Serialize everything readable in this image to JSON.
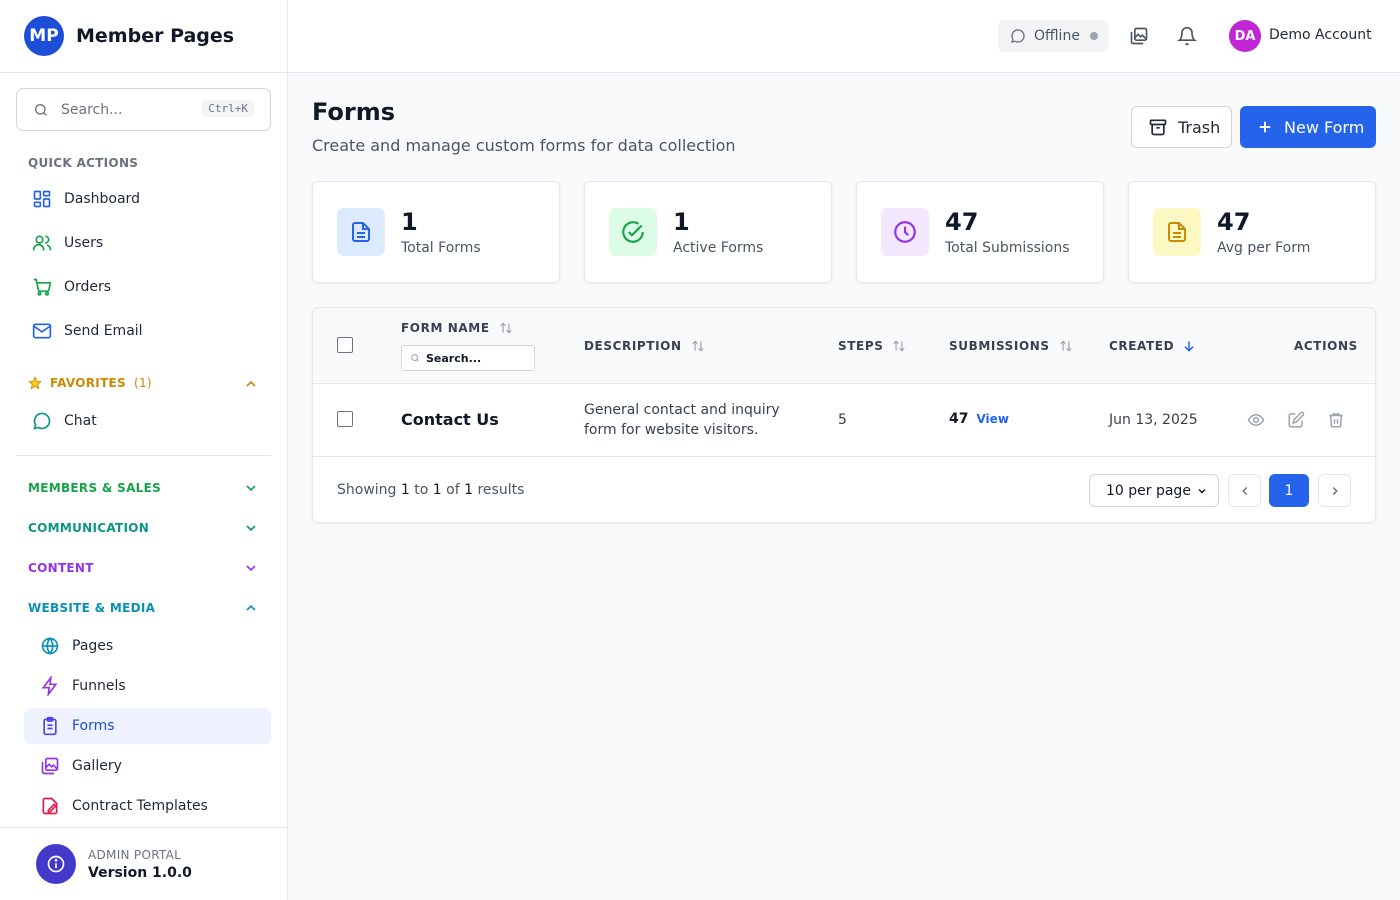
{
  "brand": {
    "logo_text": "MP",
    "name": "Member Pages"
  },
  "search": {
    "placeholder": "Search...",
    "shortcut": "Ctrl+K"
  },
  "sidebar": {
    "quick_actions_label": "QUICK ACTIONS",
    "quick_actions": [
      {
        "label": "Dashboard",
        "icon": "dashboard-icon"
      },
      {
        "label": "Users",
        "icon": "users-icon"
      },
      {
        "label": "Orders",
        "icon": "cart-icon"
      },
      {
        "label": "Send Email",
        "icon": "mail-icon"
      }
    ],
    "favorites_label": "FAVORITES",
    "favorites_count": "(1)",
    "favorites": [
      {
        "label": "Chat",
        "icon": "chat-icon"
      }
    ],
    "groups": [
      {
        "label": "MEMBERS & SALES",
        "color": "#16a34a"
      },
      {
        "label": "COMMUNICATION",
        "color": "#0d9488"
      },
      {
        "label": "CONTENT",
        "color": "#9333ea"
      },
      {
        "label": "WEBSITE & MEDIA",
        "color": "#0891b2"
      }
    ],
    "website_items": [
      {
        "label": "Pages",
        "icon": "globe-icon"
      },
      {
        "label": "Funnels",
        "icon": "bolt-icon"
      },
      {
        "label": "Forms",
        "icon": "clipboard-icon"
      },
      {
        "label": "Gallery",
        "icon": "gallery-icon"
      },
      {
        "label": "Contract Templates",
        "icon": "contract-icon"
      }
    ],
    "active_item": "Forms"
  },
  "footer": {
    "label": "ADMIN PORTAL",
    "version": "Version 1.0.0"
  },
  "topbar": {
    "status": "Offline",
    "avatar_initials": "DA",
    "account_name": "Demo Account"
  },
  "page": {
    "title": "Forms",
    "subtitle": "Create and manage custom forms for data collection",
    "trash_label": "Trash",
    "new_label": "New Form"
  },
  "stats": [
    {
      "value": "1",
      "label": "Total Forms",
      "icon": "document-icon",
      "color": "#2563eb",
      "bg": "#dbeafe"
    },
    {
      "value": "1",
      "label": "Active Forms",
      "icon": "check-circle-icon",
      "color": "#16a34a",
      "bg": "#dcfce7"
    },
    {
      "value": "47",
      "label": "Total Submissions",
      "icon": "clock-icon",
      "color": "#9333ea",
      "bg": "#f3e8ff"
    },
    {
      "value": "47",
      "label": "Avg per Form",
      "icon": "file-icon",
      "color": "#ca8a04",
      "bg": "#fef9c3"
    }
  ],
  "table": {
    "columns": {
      "name": "FORM NAME",
      "description": "DESCRIPTION",
      "steps": "STEPS",
      "submissions": "SUBMISSIONS",
      "created": "CREATED",
      "actions": "ACTIONS"
    },
    "name_filter_placeholder": "Search...",
    "rows": [
      {
        "name": "Contact Us",
        "description": "General contact and inquiry form for website visitors.",
        "steps": "5",
        "submissions": "47",
        "view_label": "View",
        "created": "Jun 13, 2025"
      }
    ]
  },
  "pagination": {
    "showing_prefix": "Showing",
    "from": "1",
    "to_word": "to",
    "to": "1",
    "of_word": "of",
    "total": "1",
    "suffix": "results",
    "per_page": "10 per page",
    "current_page": "1"
  }
}
